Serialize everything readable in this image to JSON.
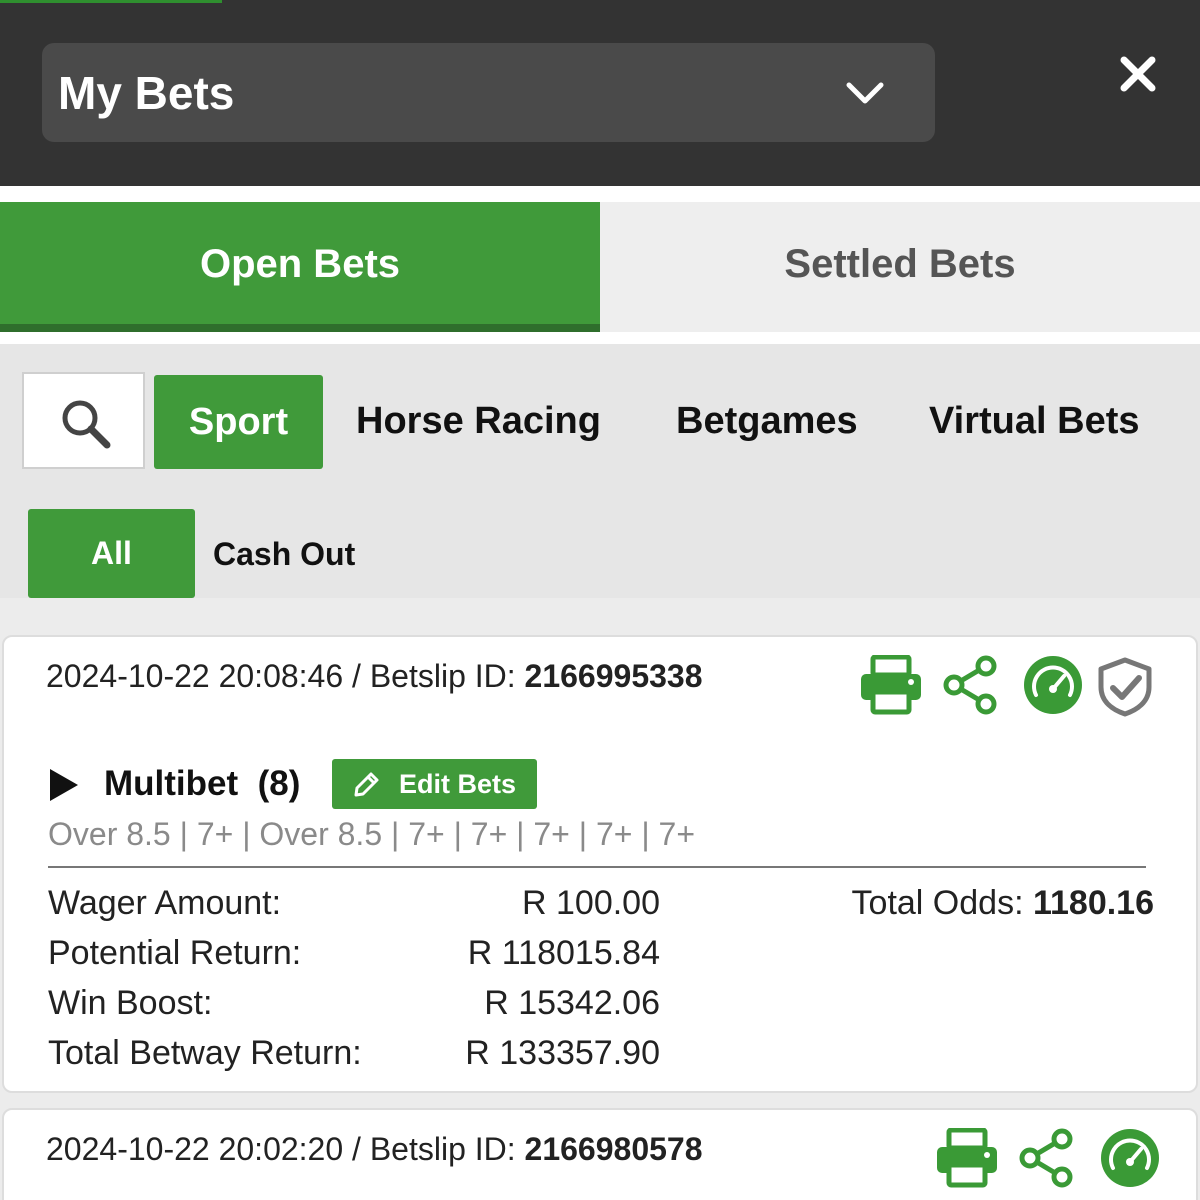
{
  "header": {
    "title": "My Bets",
    "dropdown_icon": "chevron-down-icon",
    "close_icon": "close-icon"
  },
  "tabs": [
    {
      "label": "Open Bets",
      "active": true
    },
    {
      "label": "Settled Bets",
      "active": false
    }
  ],
  "filters": {
    "search_icon": "search-icon",
    "categories": [
      "Sport",
      "Horse Racing",
      "Betgames",
      "Virtual Bets"
    ],
    "active_category": "Sport",
    "subfilters": [
      "All",
      "Cash Out"
    ],
    "active_subfilter": "All"
  },
  "bets": [
    {
      "datetime": "2024-10-22 20:08:46",
      "id_label": " / Betslip ID: ",
      "betslip_id": "2166995338",
      "type": "Multibet",
      "count": "(8)",
      "edit_label": "Edit Bets",
      "selections": "Over 8.5 | 7+ | Over 8.5 | 7+ | 7+ | 7+ | 7+ | 7+",
      "wager_label": "Wager Amount:",
      "wager_value": "R 100.00",
      "potential_label": "Potential Return:",
      "potential_value": "R 118015.84",
      "boost_label": "Win Boost:",
      "boost_value": "R 15342.06",
      "total_label": "Total Betway Return:",
      "total_value": "R 133357.90",
      "odds_label": "Total Odds: ",
      "odds_value": "1180.16"
    },
    {
      "datetime": "2024-10-22 20:02:20",
      "id_label": " / Betslip ID: ",
      "betslip_id": "2166980578"
    }
  ],
  "colors": {
    "header_bg": "#333333",
    "accent_green": "#409a3a",
    "icon_green": "#3a9a36",
    "shield_gray": "#777777"
  }
}
